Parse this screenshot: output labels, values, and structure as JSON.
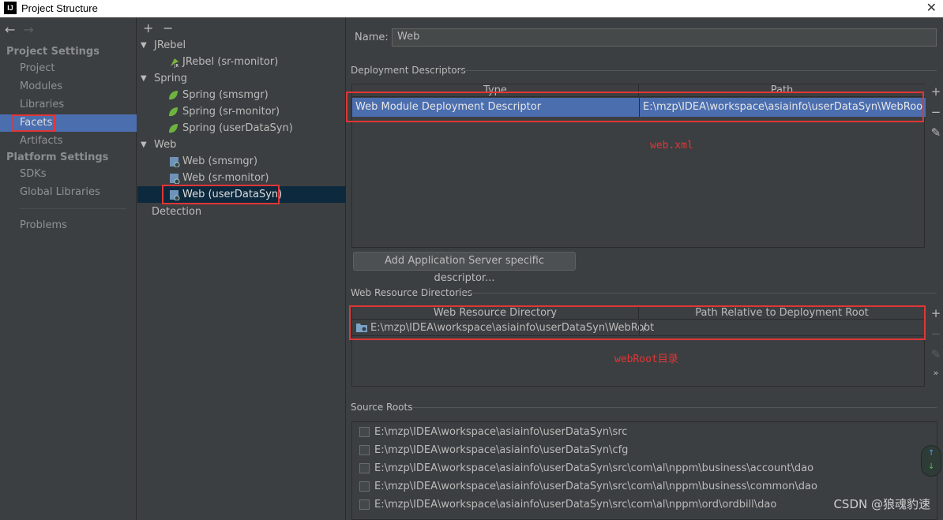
{
  "window": {
    "title": "Project Structure",
    "app_icon": "IJ"
  },
  "nav": {
    "back": "←",
    "forward": "→",
    "project_settings": "Project Settings",
    "platform_settings": "Platform Settings",
    "items": [
      "Project",
      "Modules",
      "Libraries",
      "Facets",
      "Artifacts"
    ],
    "platform_items": [
      "SDKs",
      "Global Libraries"
    ],
    "problems": "Problems"
  },
  "tree": {
    "add": "+",
    "remove": "−",
    "groups": [
      {
        "label": "JRebel",
        "children": [
          "JRebel (sr-monitor)"
        ]
      },
      {
        "label": "Spring",
        "children": [
          "Spring (smsmgr)",
          "Spring (sr-monitor)",
          "Spring (userDataSyn)"
        ]
      },
      {
        "label": "Web",
        "children": [
          "Web (smsmgr)",
          "Web (sr-monitor)",
          "Web (userDataSyn)"
        ]
      }
    ],
    "detection": "Detection"
  },
  "detail": {
    "name_label": "Name:",
    "name_value": "Web",
    "deployment": {
      "title": "Deployment Descriptors",
      "headers": [
        "Type",
        "Path"
      ],
      "row": [
        "Web Module Deployment Descriptor",
        "E:\\mzp\\IDEA\\workspace\\asiainfo\\userDataSyn\\WebRoot\\WEB"
      ],
      "annotation": "web.xml"
    },
    "add_button": "Add Application Server specific descriptor...",
    "resources": {
      "title": "Web Resource Directories",
      "headers": [
        "Web Resource Directory",
        "Path Relative to Deployment Root"
      ],
      "row": [
        "E:\\mzp\\IDEA\\workspace\\asiainfo\\userDataSyn\\WebRoot",
        "/"
      ],
      "annotation": "webRoot目录"
    },
    "source_roots": {
      "title": "Source Roots",
      "items": [
        "E:\\mzp\\IDEA\\workspace\\asiainfo\\userDataSyn\\src",
        "E:\\mzp\\IDEA\\workspace\\asiainfo\\userDataSyn\\cfg",
        "E:\\mzp\\IDEA\\workspace\\asiainfo\\userDataSyn\\src\\com\\al\\nppm\\business\\account\\dao",
        "E:\\mzp\\IDEA\\workspace\\asiainfo\\userDataSyn\\src\\com\\al\\nppm\\business\\common\\dao",
        "E:\\mzp\\IDEA\\workspace\\asiainfo\\userDataSyn\\src\\com\\al\\nppm\\ord\\ordbill\\dao"
      ]
    }
  },
  "watermark": "CSDN @狼魂豹速"
}
